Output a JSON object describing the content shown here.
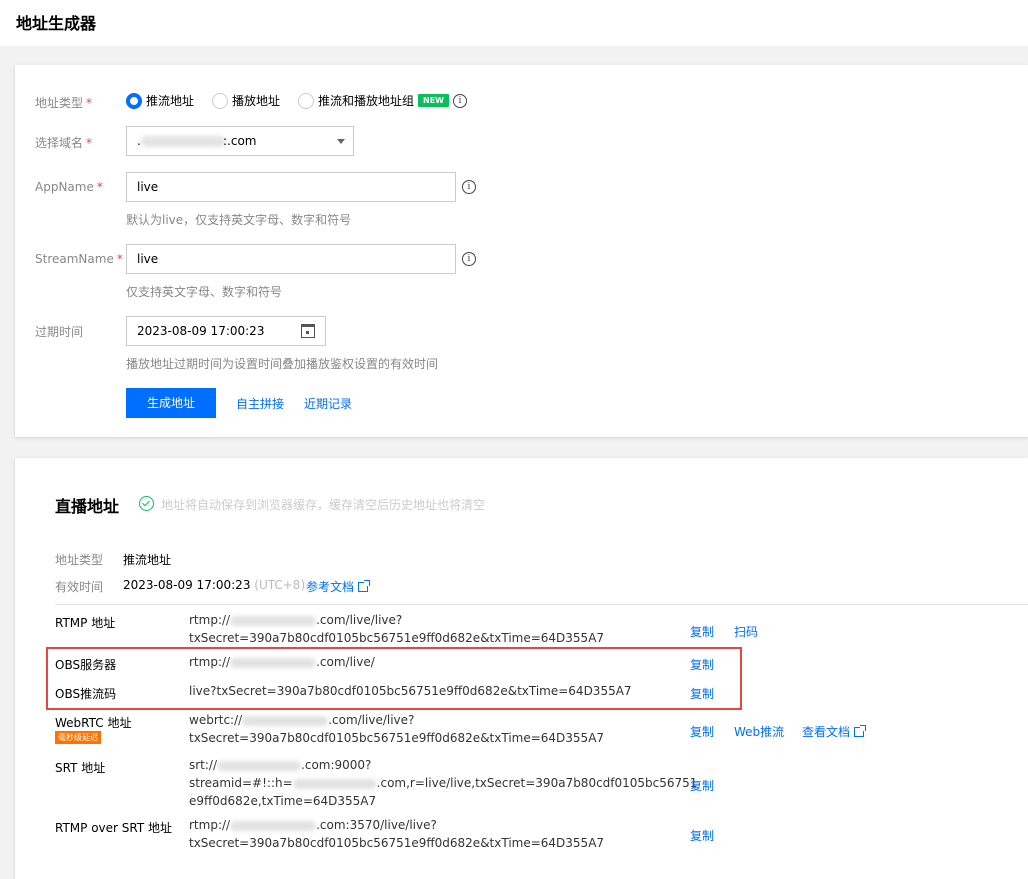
{
  "page": {
    "title": "地址生成器"
  },
  "form": {
    "addr_type_label": "地址类型",
    "addr_type_options": [
      "推流地址",
      "播放地址",
      "推流和播放地址组"
    ],
    "new_badge": "NEW",
    "domain_label": "选择域名",
    "domain_prefix": ".",
    "domain_value": ":.com",
    "appname_label": "AppName",
    "appname_value": "live",
    "appname_hint": "默认为live，仅支持英文字母、数字和符号",
    "streamname_label": "StreamName",
    "streamname_value": "live",
    "streamname_hint": "仅支持英文字母、数字和符号",
    "expire_label": "过期时间",
    "expire_value": "2023-08-09 17:00:23",
    "expire_hint": "播放地址过期时间为设置时间叠加播放鉴权设置的有效时间",
    "generate_button": "生成地址",
    "custom_link": "自主拼接",
    "recent_link": "近期记录"
  },
  "result": {
    "title": "直播地址",
    "note": "地址将自动保存到浏览器缓存，缓存清空后历史地址也将清空",
    "type_label": "地址类型",
    "type_value": "推流地址",
    "valid_label": "有效时间",
    "valid_value": "2023-08-09 17:00:23",
    "valid_tz": "(UTC+8)",
    "doc_link": "参考文档",
    "low_latency_badge": "毫秒级延迟",
    "rows": {
      "rtmp": {
        "label": "RTMP 地址",
        "l1a": "rtmp://",
        "l1b": ".com/live/live?",
        "l2": "txSecret=390a7b80cdf0105bc56751e9ff0d682e&txTime=64D355A7",
        "copy": "复制",
        "scan": "扫码"
      },
      "obs_server": {
        "label": "OBS服务器",
        "l1a": "rtmp://",
        "l1b": ".com/live/",
        "copy": "复制"
      },
      "obs_key": {
        "label": "OBS推流码",
        "l1": "live?txSecret=390a7b80cdf0105bc56751e9ff0d682e&txTime=64D355A7",
        "copy": "复制"
      },
      "webrtc": {
        "label": "WebRTC 地址",
        "l1a": "webrtc://",
        "l1b": ".com/live/live?",
        "l2": "txSecret=390a7b80cdf0105bc56751e9ff0d682e&txTime=64D355A7",
        "copy": "复制",
        "push": "Web推流",
        "doc": "查看文档"
      },
      "srt": {
        "label": "SRT 地址",
        "l1a": "srt://",
        "l1b": ".com:9000?",
        "l2a": "streamid=#!::h=",
        "l2b": ".com,r=live/live,txSecret=390a7b80cdf0105bc56751",
        "l3": "e9ff0d682e,txTime=64D355A7",
        "copy": "复制"
      },
      "rtmp_srt": {
        "label": "RTMP over SRT 地址",
        "l1a": "rtmp://",
        "l1b": ".com:3570/live/live?",
        "l2": "txSecret=390a7b80cdf0105bc56751e9ff0d682e&txTime=64D355A7",
        "copy": "复制"
      }
    }
  },
  "colors": {
    "accent": "#006eff",
    "required": "#e54545",
    "success": "#0abf5b",
    "highlight": "#e54545"
  }
}
